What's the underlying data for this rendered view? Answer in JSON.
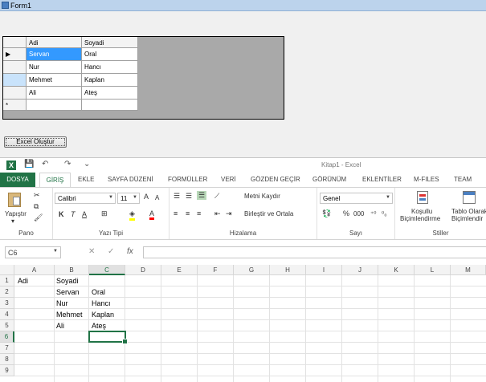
{
  "form": {
    "title": "Form1",
    "grid": {
      "headers": [
        "Adi",
        "Soyadi"
      ],
      "rows": [
        {
          "marker": "▶",
          "adi": "Servan",
          "soyadi": "Oral"
        },
        {
          "marker": "",
          "adi": "Nur",
          "soyadi": "Hancı"
        },
        {
          "marker": "",
          "adi": "Mehmet",
          "soyadi": "Kaplan"
        },
        {
          "marker": "",
          "adi": "Ali",
          "soyadi": "Ateş"
        },
        {
          "marker": "*",
          "adi": "",
          "soyadi": ""
        }
      ]
    },
    "button_label": "Excel Oluştur"
  },
  "excel": {
    "window_title": "Kitap1 - Excel",
    "app_icon_letter": "X",
    "qat": {
      "save": "💾",
      "undo": "↶",
      "redo": "↷",
      "more": "⌄"
    },
    "tabs": {
      "file": "DOSYA",
      "home": "GİRİŞ",
      "insert": "EKLE",
      "layout": "SAYFA DÜZENİ",
      "formulas": "FORMÜLLER",
      "data": "VERİ",
      "review": "GÖZDEN GEÇİR",
      "view": "GÖRÜNÜM",
      "addins": "EKLENTİLER",
      "mfiles": "M-FILES",
      "team": "TEAM"
    },
    "ribbon": {
      "clipboard": {
        "label": "Pano",
        "paste": "Yapıştır",
        "paste_arrow": "▾"
      },
      "font": {
        "label": "Yazı Tipi",
        "family": "Calibri",
        "size": "11",
        "grow": "A",
        "shrink": "A",
        "bold": "K",
        "italic": "T",
        "underline": "A"
      },
      "alignment": {
        "label": "Hizalama",
        "wrap": "Metni Kaydır",
        "merge": "Birleştir ve Ortala"
      },
      "number": {
        "label": "Sayı",
        "format": "Genel",
        "percent": "%",
        "comma": "000"
      },
      "styles": {
        "label": "Stiller",
        "cond_1": "Koşullu",
        "cond_2": "Biçimlendirme",
        "table_1": "Tablo Olarak",
        "table_2": "Biçimlendir"
      }
    },
    "formula_bar": {
      "name_box": "C6",
      "cancel": "✕",
      "enter": "✓",
      "fx": "fx",
      "value": ""
    },
    "sheet": {
      "columns": [
        "A",
        "B",
        "C",
        "D",
        "E",
        "F",
        "G",
        "H",
        "I",
        "J",
        "K",
        "L",
        "M"
      ],
      "rows": [
        "1",
        "2",
        "3",
        "4",
        "5",
        "6",
        "7",
        "8",
        "9"
      ],
      "cells": {
        "A1": "Adi",
        "B1": "Soyadi",
        "B2": "Servan",
        "C2": "Oral",
        "B3": "Nur",
        "C3": "Hancı",
        "B4": "Mehmet",
        "C4": "Kaplan",
        "B5": "Ali",
        "C5": "Ateş"
      },
      "active_cell": "C6"
    }
  }
}
